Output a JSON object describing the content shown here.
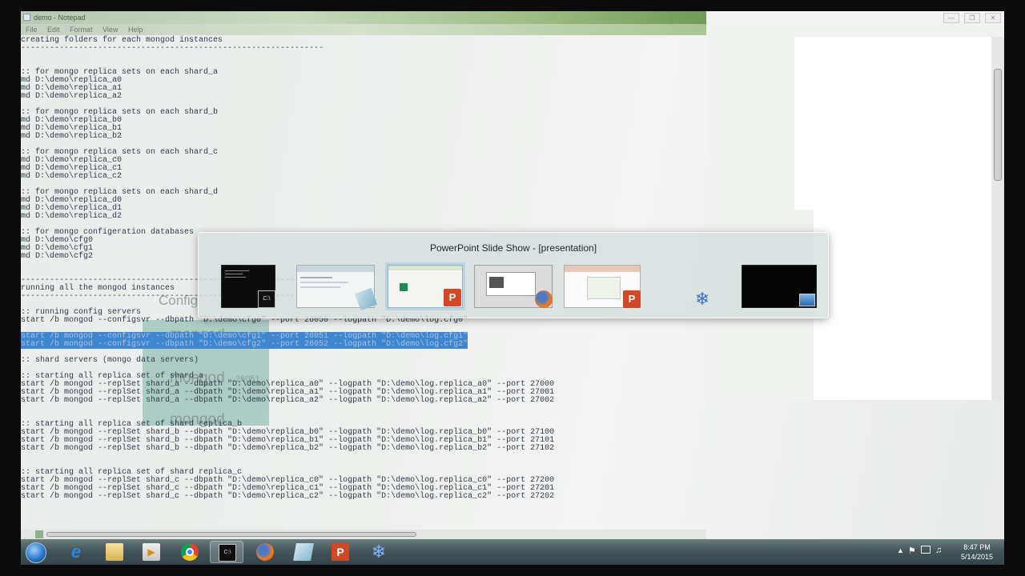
{
  "notepad": {
    "title": "demo - Notepad",
    "menu": [
      "File",
      "Edit",
      "Format",
      "View",
      "Help"
    ],
    "lines_before_selection": "creating folders for each mongod instances\n---------------------------------------------------------------\n\n\n:: for mongo replica sets on each shard_a\nmd D:\\demo\\replica_a0\nmd D:\\demo\\replica_a1\nmd D:\\demo\\replica_a2\n\n:: for mongo replica sets on each shard_b\nmd D:\\demo\\replica_b0\nmd D:\\demo\\replica_b1\nmd D:\\demo\\replica_b2\n\n:: for mongo replica sets on each shard_c\nmd D:\\demo\\replica_c0\nmd D:\\demo\\replica_c1\nmd D:\\demo\\replica_c2\n\n:: for mongo replica sets on each shard_d\nmd D:\\demo\\replica_d0\nmd D:\\demo\\replica_d1\nmd D:\\demo\\replica_d2\n\n:: for mongo configeration databases\nmd D:\\demo\\cfg0\nmd D:\\demo\\cfg1\nmd D:\\demo\\cfg2\n\n\n---------------------------------------------------------------\nrunning all the mongod instances\n---------------------------------------------------------------\n\n:: running config servers\nstart /b mongod --configsvr --dbpath \"D:\\demo\\cfg0\" --port 26050 --logpath \"D:\\demo\\log.cfg0\"\n\n",
    "selected_text": "start /b mongod --configsvr --dbpath \"D:\\demo\\cfg1\" --port 26051 --logpath \"D:\\demo\\log.cfg1\"\nstart /b mongod --configsvr --dbpath \"D:\\demo\\cfg2\" --port 26052 --logpath \"D:\\demo\\log.cfg2\"",
    "lines_after_selection": "\n\n:: shard servers (mongo data servers)\n\n:: starting all replica set of shard_a\nstart /b mongod --replSet shard_a --dbpath \"D:\\demo\\replica_a0\" --logpath \"D:\\demo\\log.replica_a0\" --port 27000\nstart /b mongod --replSet shard_a --dbpath \"D:\\demo\\replica_a1\" --logpath \"D:\\demo\\log.replica_a1\" --port 27001\nstart /b mongod --replSet shard_a --dbpath \"D:\\demo\\replica_a2\" --logpath \"D:\\demo\\log.replica_a2\" --port 27002\n\n\n:: starting all replica set of shard replica_b\nstart /b mongod --replSet shard_b --dbpath \"D:\\demo\\replica_b0\" --logpath \"D:\\demo\\log.replica_b0\" --port 27100\nstart /b mongod --replSet shard_b --dbpath \"D:\\demo\\replica_b1\" --logpath \"D:\\demo\\log.replica_b1\" --port 27101\nstart /b mongod --replSet shard_b --dbpath \"D:\\demo\\replica_b2\" --logpath \"D:\\demo\\log.replica_b2\" --port 27102\n\n\n:: starting all replica set of shard replica_c\nstart /b mongod --replSet shard_c --dbpath \"D:\\demo\\replica_c0\" --logpath \"D:\\demo\\log.replica_c0\" --port 27200\nstart /b mongod --replSet shard_c --dbpath \"D:\\demo\\replica_c1\" --logpath \"D:\\demo\\log.replica_c1\" --port 27201\nstart /b mongod --replSet shard_c --dbpath \"D:\\demo\\replica_c2\" --logpath \"D:\\demo\\log.replica_c2\" --port 27202"
  },
  "overlay_labels": {
    "config": "Config",
    "mongod_label": "mongod",
    "port_a": "26050",
    "port_b": "26051"
  },
  "right_window": {
    "buttons": [
      "minimize-icon",
      "restore-icon",
      "close-icon"
    ]
  },
  "switcher": {
    "title": "PowerPoint Slide Show - [presentation]",
    "items": [
      {
        "name": "command-prompt-window",
        "badge": "cmd-icon"
      },
      {
        "name": "explorer-window",
        "badge": "notepad-icon"
      },
      {
        "name": "powerpoint-slide-show",
        "badge": "powerpoint-icon",
        "selected": true
      },
      {
        "name": "firefox-window",
        "badge": "firefox-icon"
      },
      {
        "name": "powerpoint-editor",
        "badge": "powerpoint-icon"
      },
      {
        "name": "app-window",
        "badge": "snowflake-icon"
      },
      {
        "name": "desktop",
        "badge": "desktop-icon"
      }
    ]
  },
  "taskbar": {
    "items": [
      "start-orb-icon",
      "internet-explorer-icon",
      "explorer-folder-icon",
      "media-player-icon",
      "chrome-icon",
      "command-prompt-icon",
      "firefox-icon",
      "notepad-icon",
      "powerpoint-icon",
      "snowflake-app-icon"
    ],
    "active": "command-prompt-icon",
    "clock_time": "8:47 PM",
    "clock_date": "5/14/2015"
  },
  "colors": {
    "selection": "#3e86cf",
    "switcher_bg": "#d6dede",
    "taskbar": "#3f5055"
  }
}
